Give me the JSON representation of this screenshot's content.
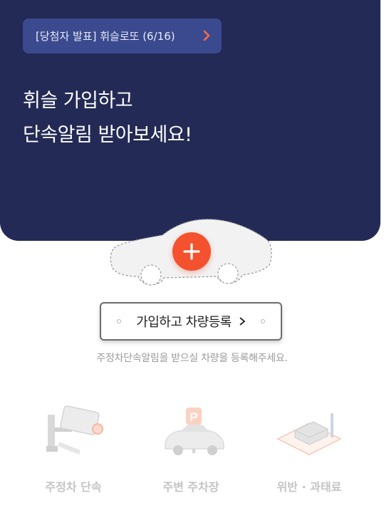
{
  "notice": {
    "text": "[당첨자 발표] 휘슬로또 (6/16)",
    "icon": "chevron-right-icon"
  },
  "headline": {
    "line1": "휘슬 가입하고",
    "line2": "단속알림 받아보세요!"
  },
  "register": {
    "button_label": "가입하고 차량등록",
    "helper_text": "주정차단속알림을 받으실 차량을 등록해주세요."
  },
  "menu": [
    {
      "label": "주정차 단속",
      "icon": "cctv-camera-icon"
    },
    {
      "label": "주변 주차장",
      "icon": "parking-car-icon"
    },
    {
      "label": "위반 · 과태료",
      "icon": "fine-ticket-icon"
    }
  ],
  "colors": {
    "hero_bg": "#232a55",
    "notice_bg": "#3b4a8f",
    "accent": "#f4512f"
  }
}
